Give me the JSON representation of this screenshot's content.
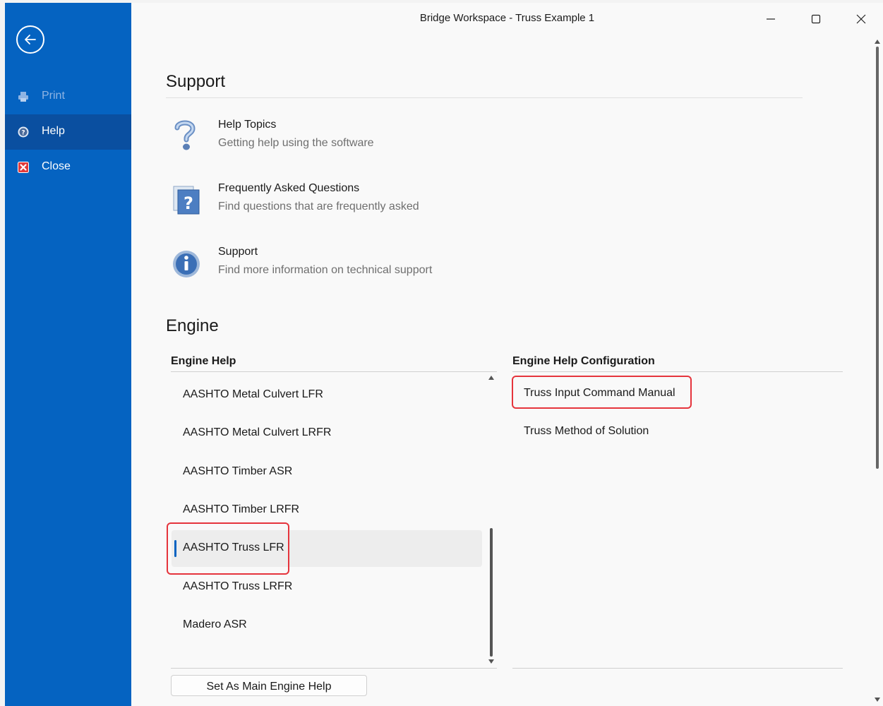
{
  "window": {
    "title": "Bridge Workspace - Truss Example 1"
  },
  "sidebar": {
    "items": [
      {
        "label": "Print",
        "icon": "printer-icon",
        "disabled": true
      },
      {
        "label": "Help",
        "icon": "help-circle-icon",
        "active": true
      },
      {
        "label": "Close",
        "icon": "close-red-icon"
      }
    ]
  },
  "support": {
    "heading": "Support",
    "items": [
      {
        "title": "Help Topics",
        "desc": "Getting help using the software",
        "icon": "question-mark-icon"
      },
      {
        "title": "Frequently Asked Questions",
        "desc": "Find questions that are frequently asked",
        "icon": "faq-icon"
      },
      {
        "title": "Support",
        "desc": "Find more information on technical support",
        "icon": "info-icon"
      }
    ]
  },
  "engine": {
    "heading": "Engine",
    "help_heading": "Engine Help",
    "config_heading": "Engine Help Configuration",
    "engines": [
      "AASHTO Metal Culvert LFR",
      "AASHTO Metal Culvert LRFR",
      "AASHTO Timber ASR",
      "AASHTO Timber LRFR",
      "AASHTO Truss LFR",
      "AASHTO Truss LRFR",
      "Madero ASR"
    ],
    "selected_engine": "AASHTO Truss LFR",
    "config_items": [
      "Truss Input Command Manual",
      "Truss Method of Solution"
    ],
    "set_main_button": "Set As Main Engine Help"
  },
  "colors": {
    "sidebar": "#0563c1",
    "highlight": "#e5343c",
    "accent": "#0563c1"
  }
}
